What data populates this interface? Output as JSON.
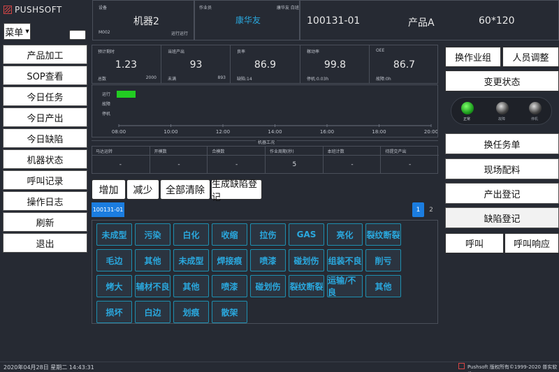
{
  "brand": "PUSHSOFT",
  "menu_label": "菜单",
  "sidebar": [
    "产品加工",
    "SOP查看",
    "今日任务",
    "今日产出",
    "今日缺陷",
    "机器状态",
    "呼叫记录",
    "操作日志",
    "刷新",
    "退出"
  ],
  "header": {
    "device_label": "设备",
    "device_name": "机器2",
    "device_code": "M002",
    "device_status": "运行运行",
    "operator_label": "作业员",
    "operator_name": "康华友",
    "operator_tag": "康华友 白班",
    "order_no": "100131-01",
    "product": "产品A",
    "spec": "60*120"
  },
  "metrics": [
    {
      "label": "预计剩时",
      "value": "1.23",
      "sub_left": "总数",
      "sub_right": "2000"
    },
    {
      "label": "当班产出",
      "value": "93",
      "sub_left": "未满",
      "sub_right": "893"
    },
    {
      "label": "良率",
      "value": "86.9",
      "sub_left": "缺陷:14",
      "sub_right": ""
    },
    {
      "label": "稼动率",
      "value": "99.8",
      "sub_left": "停机:0.03h",
      "sub_right": ""
    },
    {
      "label": "OEE",
      "value": "86.7",
      "sub_left": "故障:0h",
      "sub_right": ""
    }
  ],
  "timeline": {
    "rows": [
      "运行",
      "故障",
      "停机"
    ],
    "ticks": [
      "08:00",
      "10:00",
      "12:00",
      "14:00",
      "16:00",
      "18:00",
      "20:00"
    ],
    "run_color": "#22cc22"
  },
  "machine_section_title": "机器工况",
  "machine_table": {
    "headers": [
      "马达运转",
      "开模数",
      "合模数",
      "作业周期(秒)",
      "本班计数",
      "待提交产出"
    ],
    "values": [
      "-",
      "-",
      "-",
      "5",
      "-",
      "-"
    ]
  },
  "actions": [
    "增加",
    "减少",
    "全部清除",
    "生成缺陷登记"
  ],
  "order_tab": "100131-01",
  "pagination": [
    "1",
    "2"
  ],
  "defects": [
    [
      "未成型",
      "污染",
      "白化",
      "收缩",
      "拉伤",
      "GAS",
      "亮化",
      "裂纹断裂"
    ],
    [
      "毛边",
      "其他",
      "未成型",
      "焊接痕",
      "喷漆",
      "碰划伤",
      "组装不良",
      "削亏"
    ],
    [
      "烤大",
      "辅材不良",
      "其他",
      "喷漆",
      "碰划伤",
      "裂纹断裂",
      "运输/不良",
      "其他"
    ],
    [
      "损坏",
      "白边",
      "划痕",
      "散架"
    ]
  ],
  "right_panel": {
    "top_buttons": [
      "换作业组",
      "人员调整"
    ],
    "change_status": "变更状态",
    "leds": [
      "正常",
      "故障",
      "停机"
    ],
    "buttons": [
      "换任务单",
      "现场配料",
      "产出登记",
      "缺陷登记"
    ],
    "bottom_buttons": [
      "呼叫",
      "呼叫响应"
    ]
  },
  "footer": {
    "datetime": "2020年04月28日 星期二 14:43:31",
    "copyright": "Pushsoft 版权所有©1999-2020 普实软件"
  }
}
